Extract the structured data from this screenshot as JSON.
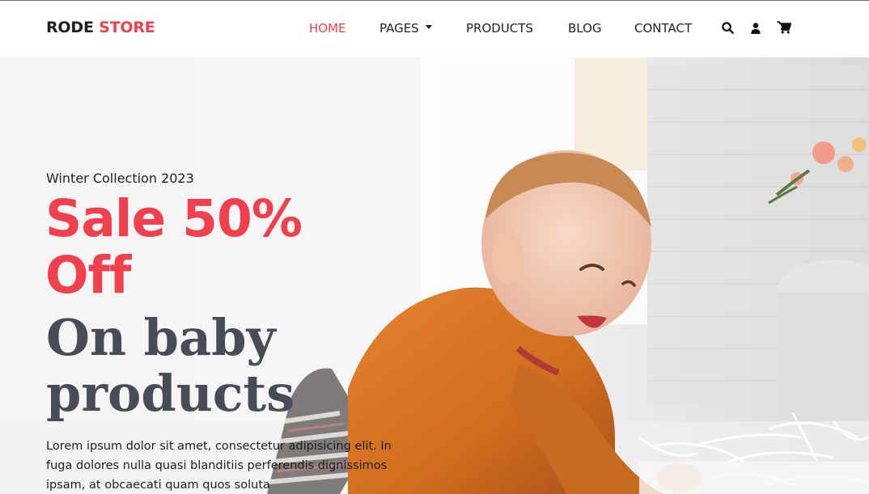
{
  "brand": {
    "part1": "RODE",
    "part2": "STORE"
  },
  "nav": {
    "home": "HOME",
    "pages": "PAGES",
    "products": "PRODUCTS",
    "blog": "BLOG",
    "contact": "CONTACT"
  },
  "icons": {
    "search": "search-icon",
    "user": "user-icon",
    "cart": "cart-icon"
  },
  "hero": {
    "eyebrow": "Winter Collection 2023",
    "headline": "Sale 50% Off",
    "subhead": "On baby products",
    "body": "Lorem ipsum dolor sit amet, consectetur adipisicing elit. In fuga dolores nulla quasi blanditiis perferendis dignissimos ipsam, at obcaecati quam quos soluta"
  },
  "colors": {
    "accent": "#f0404e",
    "text": "#1f1f1f",
    "subhead": "#474c57"
  }
}
